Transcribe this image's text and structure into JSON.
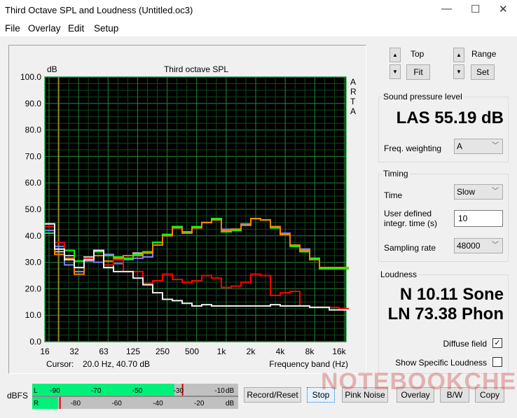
{
  "window": {
    "title": "Third Octave SPL and Loudness (Untitled.oc3)",
    "minimize": "—",
    "maximize": "☐",
    "close": "✕"
  },
  "menu": [
    "File",
    "Overlay",
    "Edit",
    "Setup"
  ],
  "controls": {
    "top_label": "Top",
    "fit_label": "Fit",
    "range_label": "Range",
    "set_label": "Set",
    "spin_up": "▲",
    "spin_down": "▼"
  },
  "spl": {
    "group_label": "Sound pressure level",
    "value": "LAS 55.19 dB",
    "weighting_label": "Freq. weighting",
    "weighting_value": "A"
  },
  "timing": {
    "group_label": "Timing",
    "time_label": "Time",
    "time_value": "Slow",
    "integr_label_1": "User defined",
    "integr_label_2": "integr. time (s)",
    "integr_value": "10",
    "sampling_label": "Sampling rate",
    "sampling_value": "48000"
  },
  "loudness": {
    "group_label": "Loudness",
    "n_value": "N 10.11 Sone",
    "ln_value": "LN 73.38 Phon",
    "diffuse_label": "Diffuse field",
    "diffuse_checked": true,
    "specific_label": "Show Specific Loudness",
    "specific_checked": false
  },
  "meter": {
    "label": "dBFS",
    "l": "L",
    "r": "R",
    "unit": "dB",
    "l_ticks": [
      "-90",
      "-70",
      "-50",
      "-30",
      "-10"
    ],
    "r_ticks": [
      "-80",
      "-60",
      "-40",
      "-20"
    ],
    "l_level_dbfs": -31,
    "l_peak_dbfs": -27,
    "r_level_dbfs": -95,
    "r_peak_dbfs": -94,
    "range": [
      -100,
      0
    ]
  },
  "buttons": [
    "Record/Reset",
    "Stop",
    "Pink Noise",
    "Overlay",
    "B/W",
    "Copy"
  ],
  "cursor": {
    "label": "Cursor:",
    "value": "20.0 Hz, 40.70 dB"
  },
  "watermark": "NOTEBOOKCHECK",
  "chart_data": {
    "type": "line",
    "title": "Third octave SPL",
    "ylabel": "dB",
    "xlabel": "Frequency band (Hz)",
    "side_label": [
      "A",
      "R",
      "T",
      "A"
    ],
    "ylim": [
      0,
      100
    ],
    "yticks": [
      "0.0",
      "10.0",
      "20.0",
      "30.0",
      "40.0",
      "50.0",
      "60.0",
      "70.0",
      "80.0",
      "90.0",
      "100.0"
    ],
    "xticks": [
      "16",
      "32",
      "63",
      "125",
      "250",
      "500",
      "1k",
      "2k",
      "4k",
      "8k",
      "16k"
    ],
    "grid": true,
    "cursor_hz": 20,
    "bands": [
      "16",
      "20",
      "25",
      "31.5",
      "40",
      "50",
      "63",
      "80",
      "100",
      "125",
      "160",
      "200",
      "250",
      "315",
      "400",
      "500",
      "630",
      "800",
      "1k",
      "1.25k",
      "1.6k",
      "2k",
      "2.5k",
      "3.15k",
      "4k",
      "5k",
      "6.3k",
      "8k",
      "10k",
      "12.5k",
      "16k"
    ],
    "series": [
      {
        "name": "gray",
        "color": "#c8c8c8",
        "values": [
          44.5,
          34.0,
          32.5,
          26.5,
          32.0,
          34.5,
          28.0,
          31.0,
          31.5,
          33.5,
          33.5,
          37.5,
          40.5,
          43.5,
          41.5,
          43.0,
          45.0,
          46.5,
          42.0,
          42.5,
          44.0,
          46.5,
          46.0,
          43.5,
          40.5,
          36.5,
          35.0,
          31.5,
          28.0,
          28.0,
          28.0
        ]
      },
      {
        "name": "blue",
        "color": "#7f7fff",
        "values": [
          42.0,
          36.0,
          29.0,
          26.5,
          30.5,
          30.0,
          33.0,
          29.5,
          31.0,
          31.5,
          32.0,
          37.5,
          40.5,
          43.5,
          41.0,
          43.0,
          45.0,
          46.5,
          42.5,
          42.5,
          44.5,
          46.5,
          46.0,
          43.5,
          41.0,
          36.5,
          35.0,
          31.5,
          28.0,
          28.0,
          28.0
        ]
      },
      {
        "name": "green",
        "color": "#00ff00",
        "values": [
          41.0,
          35.0,
          34.5,
          30.5,
          31.0,
          34.0,
          32.5,
          32.0,
          31.5,
          33.0,
          34.0,
          37.5,
          40.5,
          43.5,
          41.5,
          43.5,
          45.0,
          46.5,
          41.5,
          42.0,
          44.0,
          46.5,
          46.0,
          43.0,
          40.5,
          36.0,
          34.0,
          31.5,
          27.5,
          27.5,
          27.5
        ]
      },
      {
        "name": "orange",
        "color": "#ff8000",
        "values": [
          43.5,
          33.0,
          31.5,
          25.5,
          31.5,
          32.5,
          30.5,
          31.5,
          32.5,
          32.5,
          33.5,
          36.5,
          40.0,
          43.0,
          41.0,
          43.0,
          45.0,
          46.0,
          42.0,
          42.5,
          44.0,
          46.5,
          46.0,
          43.5,
          40.5,
          36.5,
          34.5,
          31.0,
          28.0,
          28.0,
          28.0
        ]
      },
      {
        "name": "red",
        "color": "#ff0000",
        "values": [
          43.5,
          37.5,
          31.0,
          28.0,
          31.5,
          34.5,
          29.0,
          31.0,
          26.5,
          26.5,
          22.0,
          23.0,
          25.5,
          23.5,
          22.5,
          23.0,
          25.0,
          24.0,
          20.5,
          21.0,
          22.5,
          25.5,
          25.0,
          17.5,
          18.5,
          19.0,
          13.5,
          13.0,
          13.0,
          13.0,
          12.5
        ]
      },
      {
        "name": "white",
        "color": "#f0f0f0",
        "values": [
          44.5,
          35.0,
          31.0,
          28.0,
          31.0,
          34.5,
          28.0,
          26.5,
          26.5,
          24.0,
          21.5,
          18.5,
          16.0,
          15.5,
          14.5,
          13.5,
          14.0,
          13.5,
          13.5,
          13.5,
          13.5,
          13.5,
          13.5,
          14.0,
          13.5,
          13.5,
          13.5,
          13.0,
          13.0,
          12.0,
          12.0
        ]
      }
    ]
  }
}
